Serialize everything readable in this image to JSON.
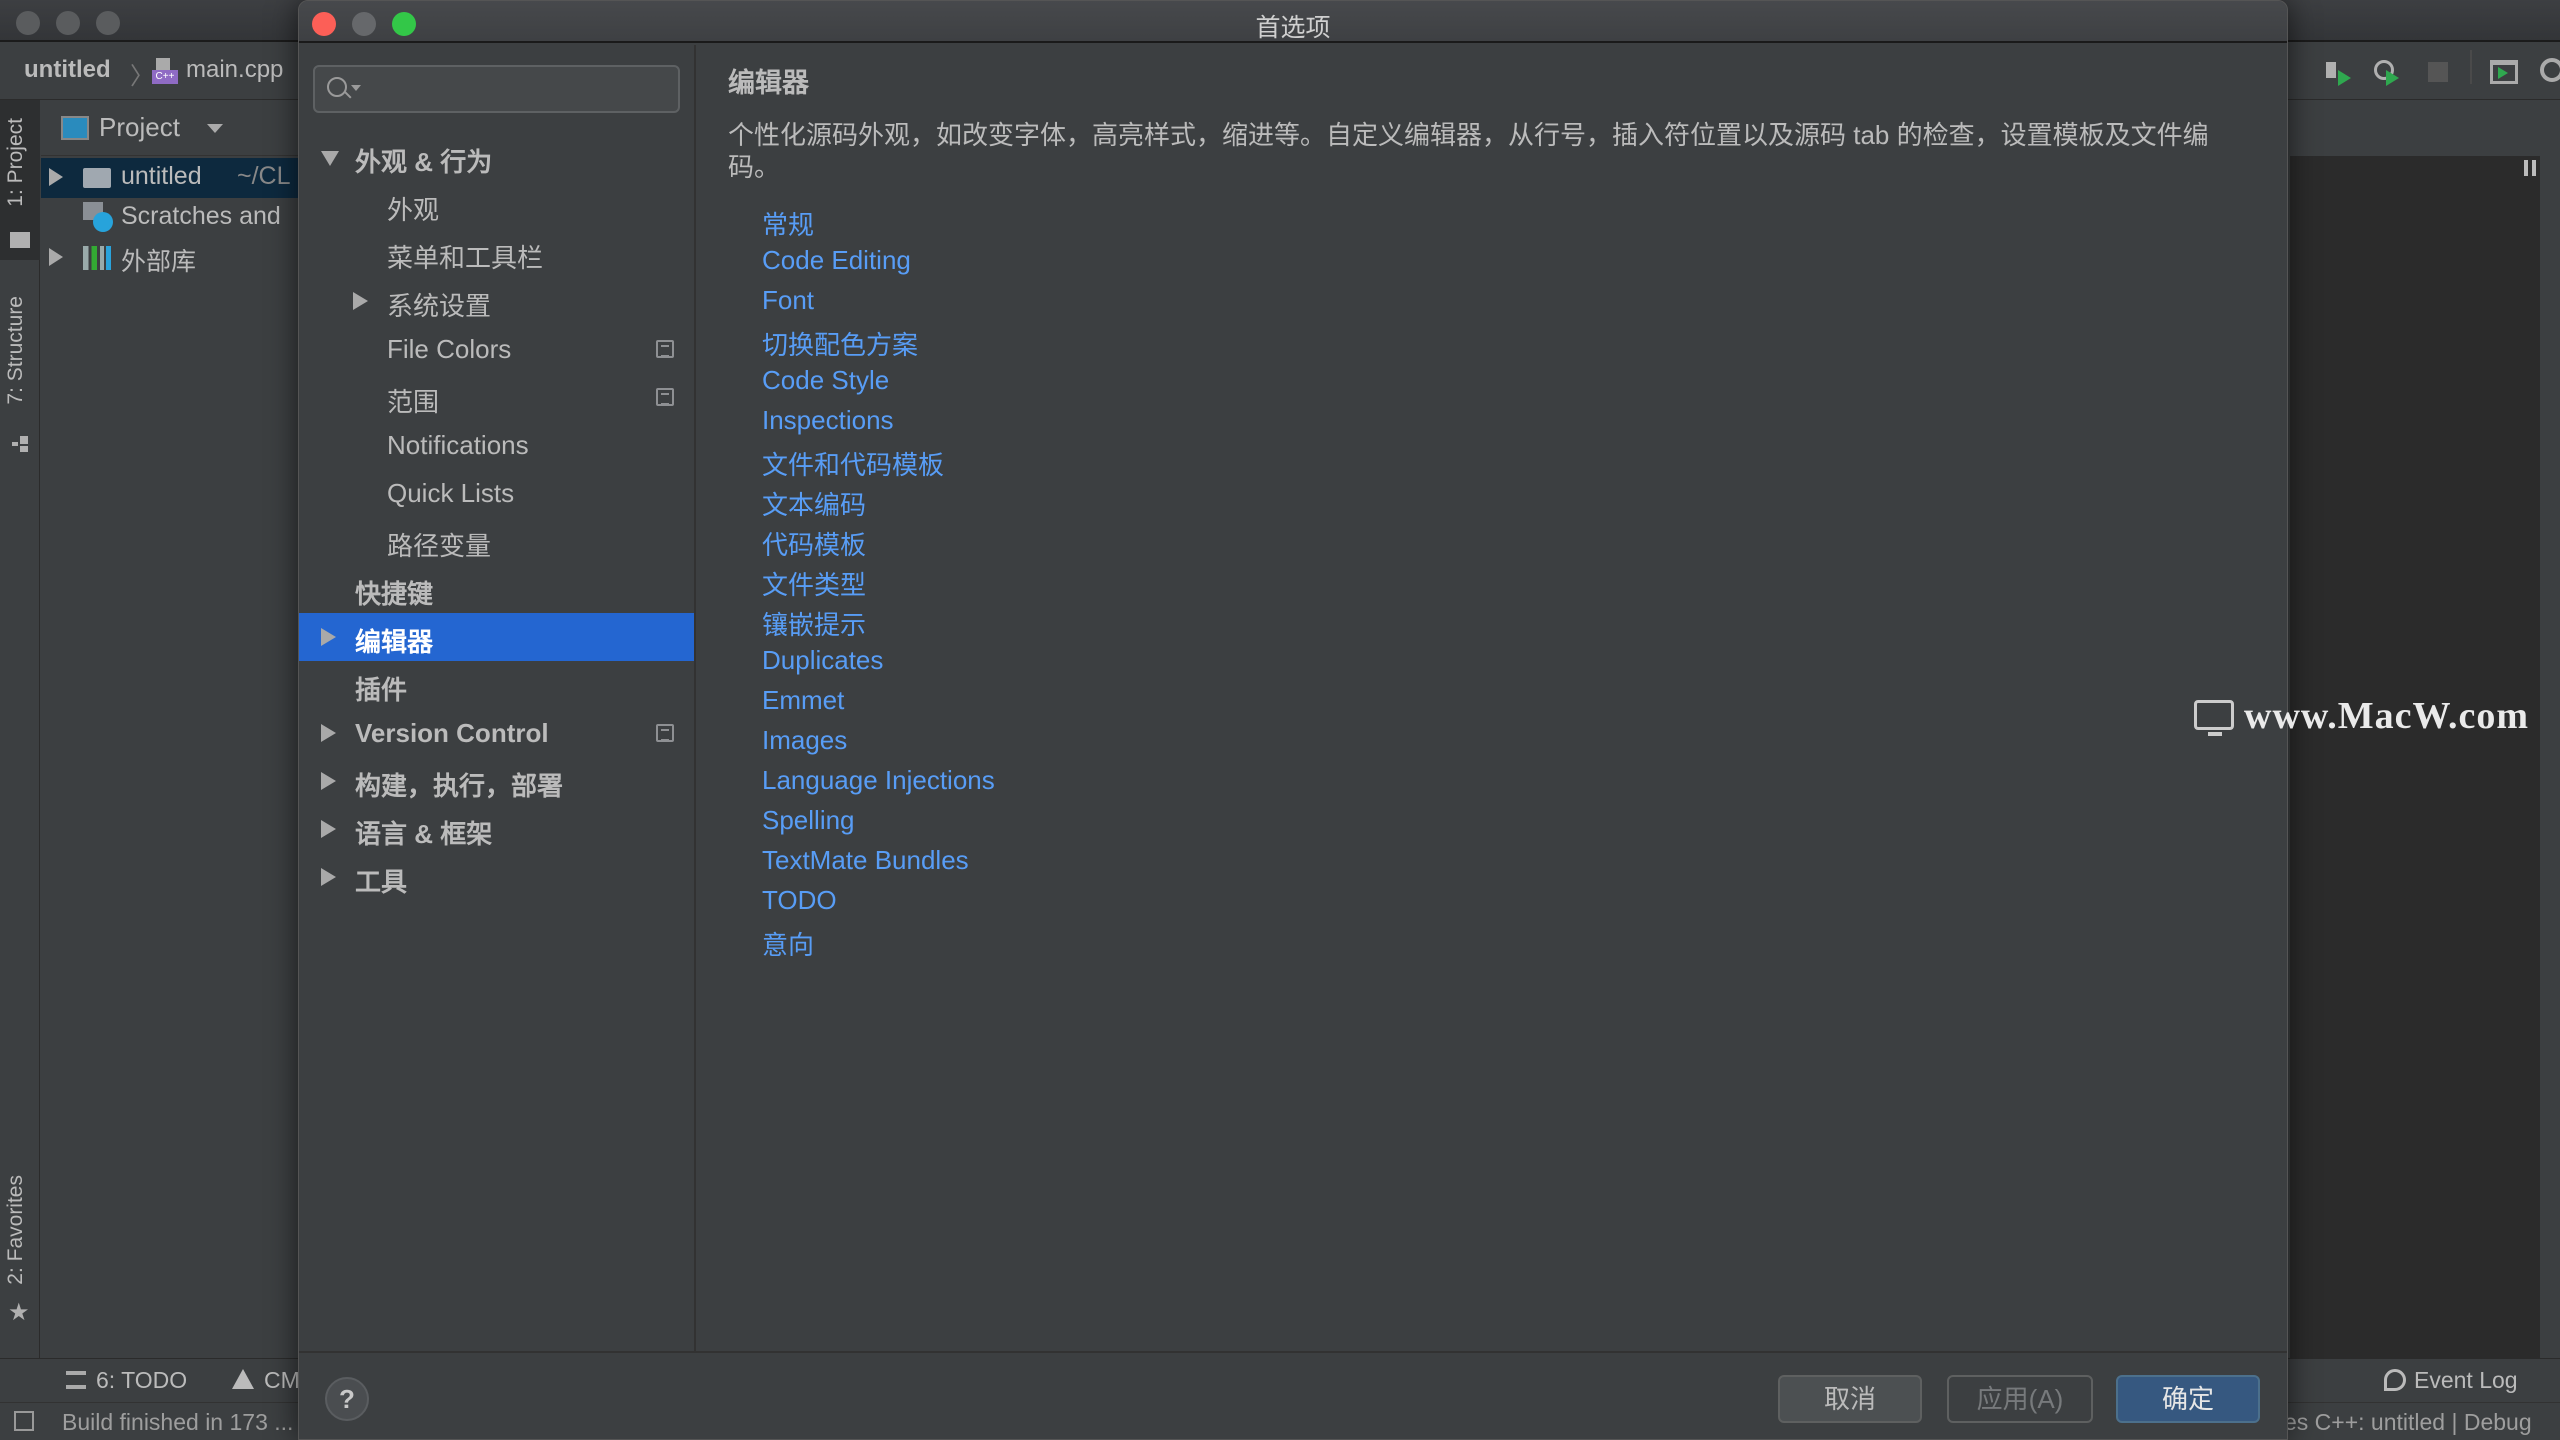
{
  "ide": {
    "breadcrumb": {
      "project": "untitled",
      "file": "main.cpp"
    },
    "tool_windows": {
      "project": "1: Project",
      "structure": "7: Structure",
      "favorites": "2: Favorites"
    },
    "project_panel": {
      "title": "Project",
      "items": [
        {
          "label": "untitled",
          "path": "~/CL",
          "selected": true
        },
        {
          "label": "Scratches and"
        },
        {
          "label": "外部库"
        }
      ]
    },
    "bottom_tabs": {
      "todo": "6: TODO",
      "cmake": "CM",
      "event_log": "Event Log"
    },
    "status": {
      "build": "Build finished in 173 ...",
      "context": "es   C++: untitled | Debug"
    }
  },
  "dialog": {
    "title": "首选项",
    "search": {
      "placeholder": "",
      "value": ""
    },
    "nav": [
      {
        "label": "外观 & 行为",
        "level": 0,
        "expanded": true,
        "bold": true
      },
      {
        "label": "外观",
        "level": 1
      },
      {
        "label": "菜单和工具栏",
        "level": 1
      },
      {
        "label": "系统设置",
        "level": 1,
        "expandable": true
      },
      {
        "label": "File Colors",
        "level": 1,
        "project_icon": true
      },
      {
        "label": "范围",
        "level": 1,
        "project_icon": true
      },
      {
        "label": "Notifications",
        "level": 1
      },
      {
        "label": "Quick Lists",
        "level": 1
      },
      {
        "label": "路径变量",
        "level": 1
      },
      {
        "label": "快捷键",
        "level": 0,
        "bold": true
      },
      {
        "label": "编辑器",
        "level": 0,
        "bold": true,
        "expandable": true,
        "selected": true
      },
      {
        "label": "插件",
        "level": 0,
        "bold": true
      },
      {
        "label": "Version Control",
        "level": 0,
        "bold": true,
        "expandable": true,
        "project_icon": true
      },
      {
        "label": "构建，执行，部署",
        "level": 0,
        "bold": true,
        "expandable": true
      },
      {
        "label": "语言 & 框架",
        "level": 0,
        "bold": true,
        "expandable": true
      },
      {
        "label": "工具",
        "level": 0,
        "bold": true,
        "expandable": true
      }
    ],
    "content": {
      "title": "编辑器",
      "description": "个性化源码外观，如改变字体，高亮样式，缩进等。自定义编辑器，从行号，插入符位置以及源码 tab 的检查，设置模板及文件编码。",
      "links": [
        "常规",
        "Code Editing",
        "Font",
        "切换配色方案",
        "Code Style",
        "Inspections",
        "文件和代码模板",
        "文本编码",
        "代码模板",
        "文件类型",
        "镶嵌提示",
        "Duplicates",
        "Emmet",
        "Images",
        "Language Injections",
        "Spelling",
        "TextMate Bundles",
        "TODO",
        "意向"
      ]
    },
    "footer": {
      "help": "?",
      "cancel": "取消",
      "apply": "应用(A)",
      "ok": "确定"
    }
  },
  "watermark": "www.MacW.com",
  "colors": {
    "selection": "#2466d1",
    "link": "#589df6",
    "ok_button": "#365880"
  }
}
